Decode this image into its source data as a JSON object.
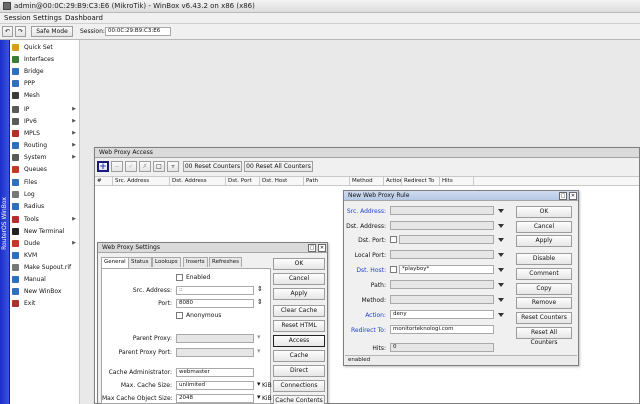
{
  "window": {
    "title": "admin@00:0C:29:B9:C3:E6 (MikroTik) - WinBox v6.43.2 on x86 (x86)"
  },
  "menubar": {
    "items": [
      "Session",
      "Settings",
      "Dashboard"
    ]
  },
  "toolbar": {
    "safe_mode": "Safe Mode",
    "session_label": "Session:",
    "session_value": "00:0C:29:B9:C3:E6"
  },
  "sidebar": {
    "vertical_label": "RouterOS WinBox"
  },
  "menu": [
    {
      "label": "Quick Set",
      "icon": "quick-set-icon",
      "color": "#d4a017",
      "submenu": false
    },
    {
      "label": "Interfaces",
      "icon": "interfaces-icon",
      "color": "#3a7d3a",
      "submenu": false
    },
    {
      "label": "Bridge",
      "icon": "bridge-icon",
      "color": "#2f6fbf",
      "submenu": false
    },
    {
      "label": "PPP",
      "icon": "ppp-icon",
      "color": "#2f6fbf",
      "submenu": false
    },
    {
      "label": "Mesh",
      "icon": "mesh-icon",
      "color": "#3a3a3a",
      "submenu": false
    },
    {
      "label": "IP",
      "icon": "ip-icon",
      "color": "#5a5a5a",
      "submenu": true
    },
    {
      "label": "IPv6",
      "icon": "ipv6-icon",
      "color": "#5a5a5a",
      "submenu": true
    },
    {
      "label": "MPLS",
      "icon": "mpls-icon",
      "color": "#b03030",
      "submenu": true
    },
    {
      "label": "Routing",
      "icon": "routing-icon",
      "color": "#2f6fbf",
      "submenu": true
    },
    {
      "label": "System",
      "icon": "system-icon",
      "color": "#5a5a5a",
      "submenu": true
    },
    {
      "label": "Queues",
      "icon": "queues-icon",
      "color": "#c0392b",
      "submenu": false
    },
    {
      "label": "Files",
      "icon": "files-icon",
      "color": "#2f6fbf",
      "submenu": false
    },
    {
      "label": "Log",
      "icon": "log-icon",
      "color": "#777777",
      "submenu": false
    },
    {
      "label": "Radius",
      "icon": "radius-icon",
      "color": "#2f6fbf",
      "submenu": false
    },
    {
      "label": "Tools",
      "icon": "tools-icon",
      "color": "#b03030",
      "submenu": true
    },
    {
      "label": "New Terminal",
      "icon": "terminal-icon",
      "color": "#222222",
      "submenu": false
    },
    {
      "label": "Dude",
      "icon": "dude-icon",
      "color": "#c0392b",
      "submenu": true
    },
    {
      "label": "KVM",
      "icon": "kvm-icon",
      "color": "#2f6fbf",
      "submenu": false
    },
    {
      "label": "Make Supout.rif",
      "icon": "supout-icon",
      "color": "#777777",
      "submenu": false
    },
    {
      "label": "Manual",
      "icon": "manual-icon",
      "color": "#2f6fbf",
      "submenu": false
    },
    {
      "label": "New WinBox",
      "icon": "winbox-icon",
      "color": "#2f6fbf",
      "submenu": false
    },
    {
      "label": "Exit",
      "icon": "exit-icon",
      "color": "#b03030",
      "submenu": false
    }
  ],
  "access": {
    "title": "Web Proxy Access",
    "reset_counters": "Reset Counters",
    "reset_all_counters": "Reset All Counters",
    "columns": [
      "#",
      "Src. Address",
      "Dst. Address",
      "Dst. Port",
      "Dst. Host",
      "Path",
      "Method",
      "Action",
      "Redirect To",
      "Hits"
    ]
  },
  "settings": {
    "title": "Web Proxy Settings",
    "tabs": [
      "General",
      "Status",
      "Lookups",
      "Inserts",
      "Refreshes"
    ],
    "enabled": "Enabled",
    "src_address_label": "Src. Address:",
    "src_address": "::",
    "port_label": "Port:",
    "port": "8080",
    "anonymous": "Anonymous",
    "parent_proxy_label": "Parent Proxy:",
    "parent_proxy_port_label": "Parent Proxy Port:",
    "cache_admin_label": "Cache Administrator:",
    "cache_admin": "webmaster",
    "max_cache_size_label": "Max. Cache Size:",
    "max_cache_size": "unlimited",
    "max_cache_obj_label": "Max Cache Object Size:",
    "max_cache_obj": "2048",
    "unit": "KiB",
    "buttons": [
      "OK",
      "Cancel",
      "Apply",
      "Clear Cache",
      "Reset HTML",
      "Access",
      "Cache",
      "Direct",
      "Connections",
      "Cache Contents"
    ]
  },
  "rule": {
    "title": "New Web Proxy Rule",
    "src_address_label": "Src. Address:",
    "dst_address_label": "Dst. Address:",
    "dst_port_label": "Dst. Port:",
    "local_port_label": "Local Port:",
    "dst_host_label": "Dst. Host:",
    "dst_host": "*playboy*",
    "path_label": "Path:",
    "method_label": "Method:",
    "action_label": "Action:",
    "action": "deny",
    "redirect_label": "Redirect To:",
    "redirect": "monitorteknologi.com",
    "hits_label": "Hits:",
    "hits": "0",
    "status": "enabled",
    "buttons": [
      "OK",
      "Cancel",
      "Apply",
      "Disable",
      "Comment",
      "Copy",
      "Remove",
      "Reset Counters",
      "Reset All Counters"
    ]
  }
}
